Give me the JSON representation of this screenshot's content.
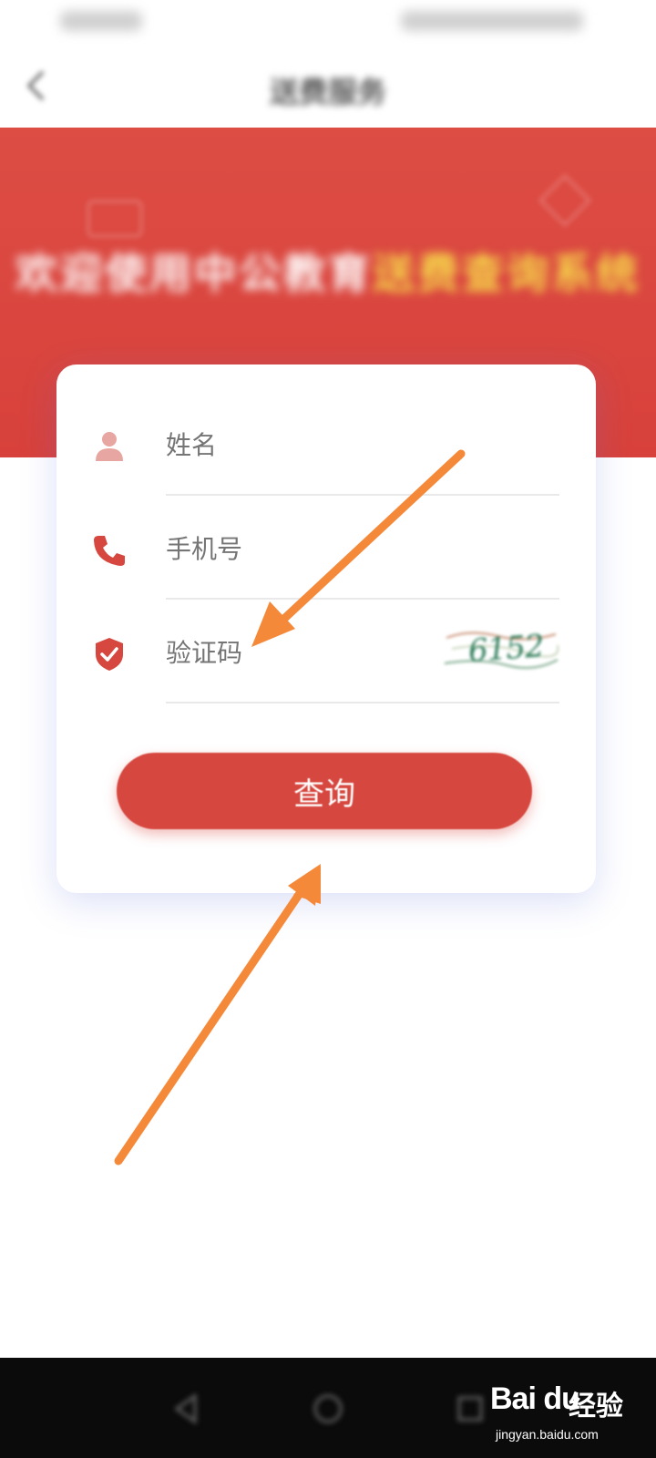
{
  "nav": {
    "title": "送费服务"
  },
  "banner": {
    "title_white": "欢迎使用中公教育",
    "title_yellow": "送费查询系统"
  },
  "form": {
    "name_placeholder": "姓名",
    "phone_placeholder": "手机号",
    "captcha_placeholder": "验证码",
    "captcha_code": "6152",
    "submit_label": "查询"
  },
  "colors": {
    "brand_red": "#d6473f",
    "banner_yellow": "#f6d84a",
    "arrow_orange": "#f5893a"
  },
  "watermark": {
    "logo": "Bai du",
    "brand": "经验",
    "url": "jingyan.baidu.com"
  }
}
